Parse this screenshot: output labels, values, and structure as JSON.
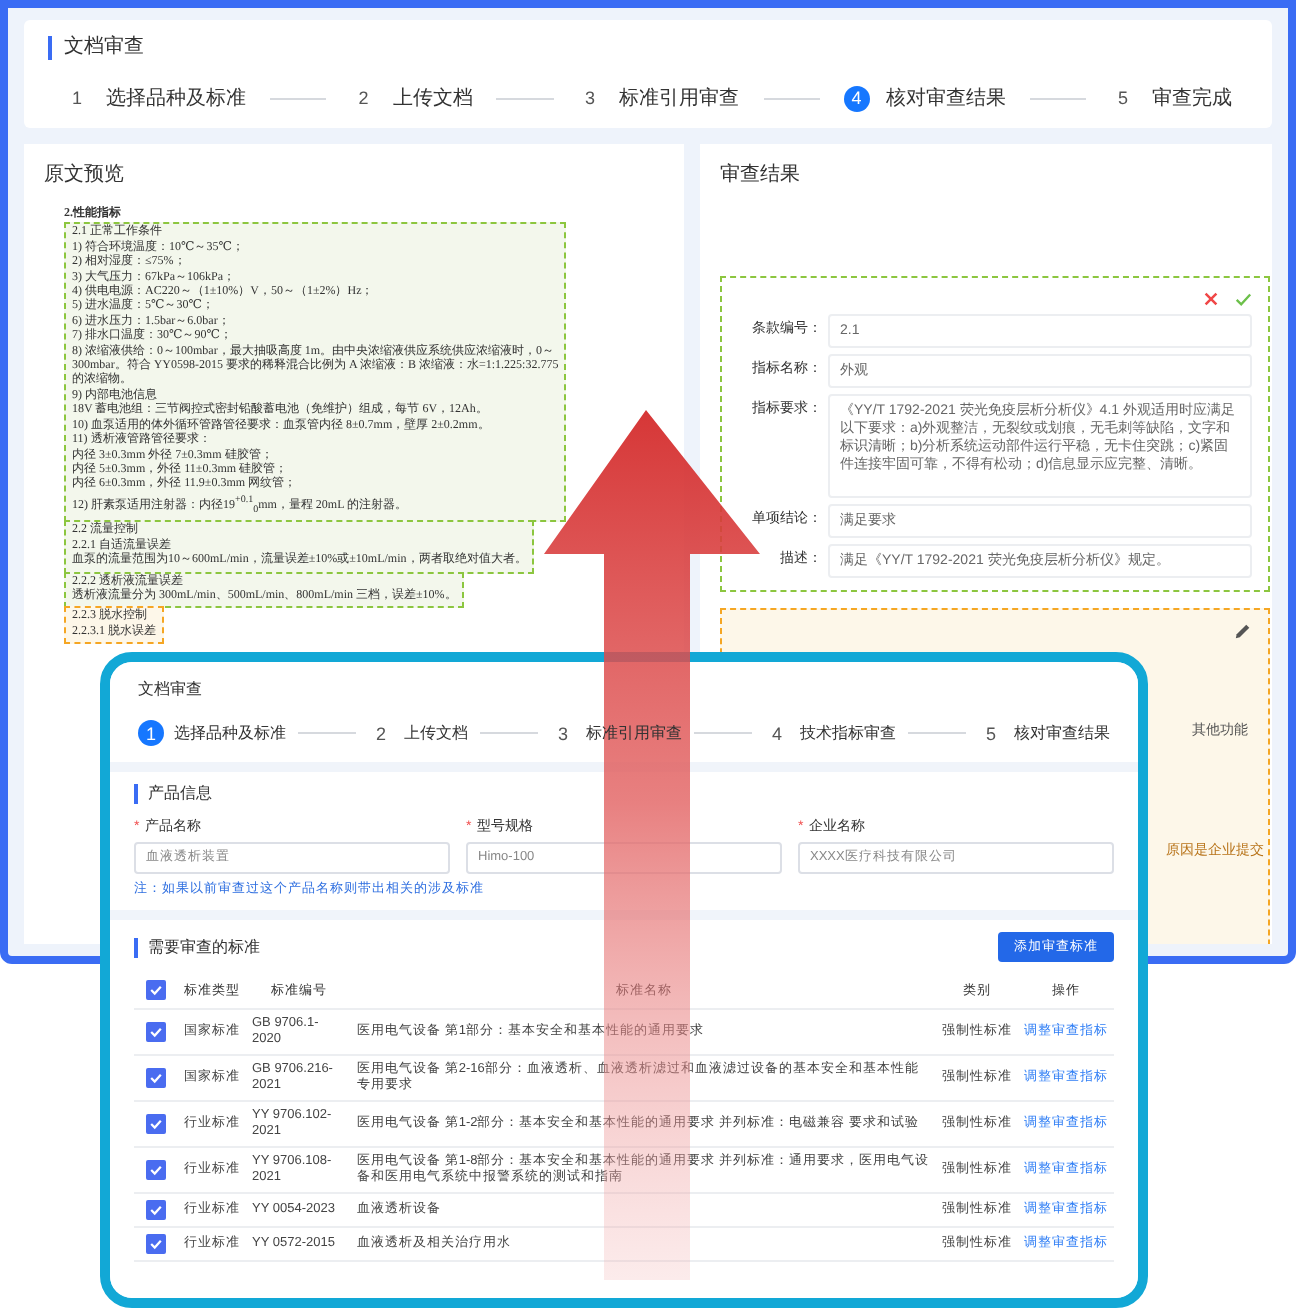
{
  "back_window": {
    "title": "文档审查",
    "steps": [
      {
        "number": "1",
        "label": "选择品种及标准",
        "selected": false
      },
      {
        "number": "2",
        "label": "上传文档",
        "selected": false
      },
      {
        "number": "3",
        "label": "标准引用审查",
        "selected": false
      },
      {
        "number": "4",
        "label": "核对审查结果",
        "selected": true
      },
      {
        "number": "5",
        "label": "审查完成",
        "selected": false
      }
    ],
    "preview": {
      "title": "原文预览",
      "heading": "2.性能指标",
      "blocks": [
        {
          "kind": "match",
          "lines": [
            "2.1 正常工作条件",
            "1) 符合环境温度：10℃～35℃；",
            "2) 相对湿度：≤75%；",
            "3) 大气压力：67kPa～106kPa；",
            "4) 供电电源：AC220～（1±10%）V，50～（1±2%）Hz；",
            "5) 进水温度：5℃～30℃；",
            "6) 进水压力：1.5bar～6.0bar；",
            "7) 排水口温度：30℃～90℃；",
            "8) 浓缩液供给：0～100mbar，最大抽吸高度 1m。由中央浓缩液供应系统供应浓缩液时，0～",
            "300mbar。符合 YY0598-2015 要求的稀释混合比例为 A 浓缩液：B 浓缩液：水=1:1.225:32.775",
            "的浓缩物。",
            "9) 内部电池信息",
            "18V 蓄电池组：三节阀控式密封铅酸蓄电池（免维护）组成，每节 6V，12Ah。",
            "10) 血泵适用的体外循环管路管径要求：血泵管内径 8±0.7mm，壁厚 2±0.2mm。",
            "11) 透析液管路管径要求：",
            "内径 3±0.3mm 外径 7±0.3mm 硅胶管；",
            "内径 5±0.3mm，外径 11±0.3mm 硅胶管；",
            "内径 6±0.3mm，外径 11.9±0.3mm 网纹管；",
            "12) 肝素泵适用注射器：内径19$^{+0.1}$$_{0}$mm，量程 20mL 的注射器。"
          ]
        },
        {
          "kind": "match",
          "lines": [
            "2.2 流量控制",
            "2.2.1 自适流量误差",
            "血泵的流量范围为10～600mL/min，流量误差±10%或±10mL/min，两者取绝对值大者。"
          ]
        },
        {
          "kind": "match",
          "lines": [
            "2.2.2 透析液流量误差",
            "透析液流量分为 300mL/min、500mL/min、800mL/min 三档，误差±10%。"
          ]
        },
        {
          "kind": "pending",
          "lines": [
            "2.2.3 脱水控制",
            "2.2.3.1 脱水误差"
          ]
        }
      ]
    },
    "result": {
      "title": "审查结果",
      "fields": [
        {
          "label": "条款编号：",
          "value": "2.1",
          "kind": "short"
        },
        {
          "label": "指标名称：",
          "value": "外观",
          "kind": "short"
        },
        {
          "label": "指标要求：",
          "value": "《YY/T 1792-2021 荧光免疫层析分析仪》4.1 外观适用时应满足以下要求：a)外观整洁，无裂纹或划痕，无毛刺等缺陷，文字和标识清晰；b)分析系统运动部件运行平稳，无卡住突跳；c)紧固件连接牢固可靠，不得有松动；d)信息显示应完整、清晰。",
          "kind": "long"
        },
        {
          "label": "单项结论：",
          "value": "满足要求",
          "kind": "short"
        },
        {
          "label": "描述：",
          "value": "满足《YY/T 1792-2021 荧光免疫层析分析仪》规定。",
          "kind": "short"
        }
      ],
      "pending_lines": [
        {
          "text": "其他功能",
          "kind": "plain"
        },
        {
          "text": "原因是企业提交",
          "kind": "reason"
        }
      ]
    }
  },
  "front_window": {
    "title": "文档审查",
    "steps": [
      {
        "number": "1",
        "label": "选择品种及标准",
        "selected": true
      },
      {
        "number": "2",
        "label": "上传文档",
        "selected": false
      },
      {
        "number": "3",
        "label": "标准引用审查",
        "selected": false
      },
      {
        "number": "4",
        "label": "技术指标审查",
        "selected": false
      },
      {
        "number": "5",
        "label": "核对审查结果",
        "selected": false
      }
    ],
    "product": {
      "title": "产品信息",
      "fields": [
        {
          "label": "产品名称",
          "required_mark": "*",
          "value": "血液透析装置"
        },
        {
          "label": "型号规格",
          "required_mark": "*",
          "value": "Himo-100"
        },
        {
          "label": "企业名称",
          "required_mark": "*",
          "value": "XXXX医疗科技有限公司"
        }
      ],
      "note": "注：如果以前审查过这个产品名称则带出相关的涉及标准"
    },
    "standards": {
      "title": "需要审查的标准",
      "add_button": "添加审查标准",
      "all_checked": true,
      "columns": [
        "标准类型",
        "标准编号",
        "标准名称",
        "类别",
        "操作"
      ],
      "rows": [
        {
          "checked": true,
          "type": "国家标准",
          "code": "GB 9706.1-2020",
          "name": "医用电气设备 第1部分：基本安全和基本性能的通用要求",
          "category": "强制性标准",
          "action": "调整审查指标"
        },
        {
          "checked": true,
          "type": "国家标准",
          "code": "GB 9706.216-2021",
          "name": "医用电气设备 第2-16部分：血液透析、血液透析滤过和血液滤过设备的基本安全和基本性能专用要求",
          "category": "强制性标准",
          "action": "调整审查指标"
        },
        {
          "checked": true,
          "type": "行业标准",
          "code": "YY 9706.102-2021",
          "name": "医用电气设备 第1-2部分：基本安全和基本性能的通用要求 并列标准：电磁兼容 要求和试验",
          "category": "强制性标准",
          "action": "调整审查指标"
        },
        {
          "checked": true,
          "type": "行业标准",
          "code": "YY 9706.108-2021",
          "name": "医用电气设备 第1-8部分：基本安全和基本性能的通用要求 并列标准：通用要求，医用电气设备和医用电气系统中报警系统的测试和指南",
          "category": "强制性标准",
          "action": "调整审查指标"
        },
        {
          "checked": true,
          "type": "行业标准",
          "code": "YY 0054-2023",
          "name": "血液透析设备",
          "category": "强制性标准",
          "action": "调整审查指标"
        },
        {
          "checked": true,
          "type": "行业标准",
          "code": "YY 0572-2015",
          "name": "血液透析及相关治疗用水",
          "category": "强制性标准",
          "action": "调整审查指标"
        }
      ]
    }
  }
}
